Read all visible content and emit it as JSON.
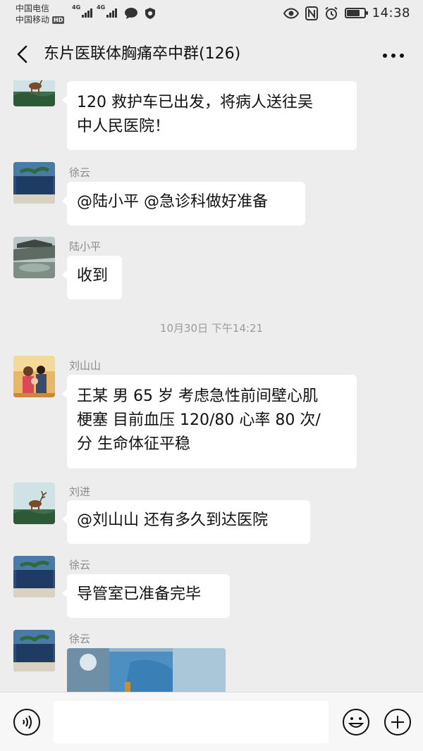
{
  "status_bar": {
    "carrier_1": "中国电信",
    "carrier_2": "中国移动",
    "hd_label": "HD",
    "network_1": "4G",
    "network_2": "4G",
    "time": "14:38",
    "battery_level": 0.75
  },
  "header": {
    "title": "东片医联体胸痛卒中群(126)",
    "back_icon": "chevron-left-icon",
    "more_icon": "more-horizontal-icon"
  },
  "messages": [
    {
      "sender": "",
      "text_line1": "120 救护车已出发，将病人送往吴",
      "text_line2": "中人民医院！",
      "avatar": "deer-avatar"
    },
    {
      "sender": "徐云",
      "text": "@陆小平 @急诊科做好准备",
      "avatar": "building-avatar"
    },
    {
      "sender": "陆小平",
      "text": "收到",
      "avatar": "garden-avatar"
    },
    {
      "sender": "刘山山",
      "text_line1": "王某 男 65 岁 考虑急性前间壁心肌",
      "text_line2": "梗塞 目前血压 120/80 心率 80 次/",
      "text_line3": "分 生命体征平稳",
      "avatar": "family-photo-avatar"
    },
    {
      "sender": "刘进",
      "text": "@刘山山  还有多久到达医院",
      "avatar": "deer-avatar"
    },
    {
      "sender": "徐云",
      "text": "导管室已准备完毕",
      "avatar": "building-avatar"
    },
    {
      "sender": "徐云",
      "type": "image",
      "avatar": "building-avatar"
    }
  ],
  "timestamp": "10月30日 下午14:21",
  "input_bar": {
    "voice_icon": "voice-icon",
    "emoji_icon": "emoji-icon",
    "add_icon": "plus-icon",
    "input_value": ""
  },
  "colors": {
    "background": "#ededed",
    "bubble": "#ffffff",
    "sender_name": "#8a8a8a"
  }
}
